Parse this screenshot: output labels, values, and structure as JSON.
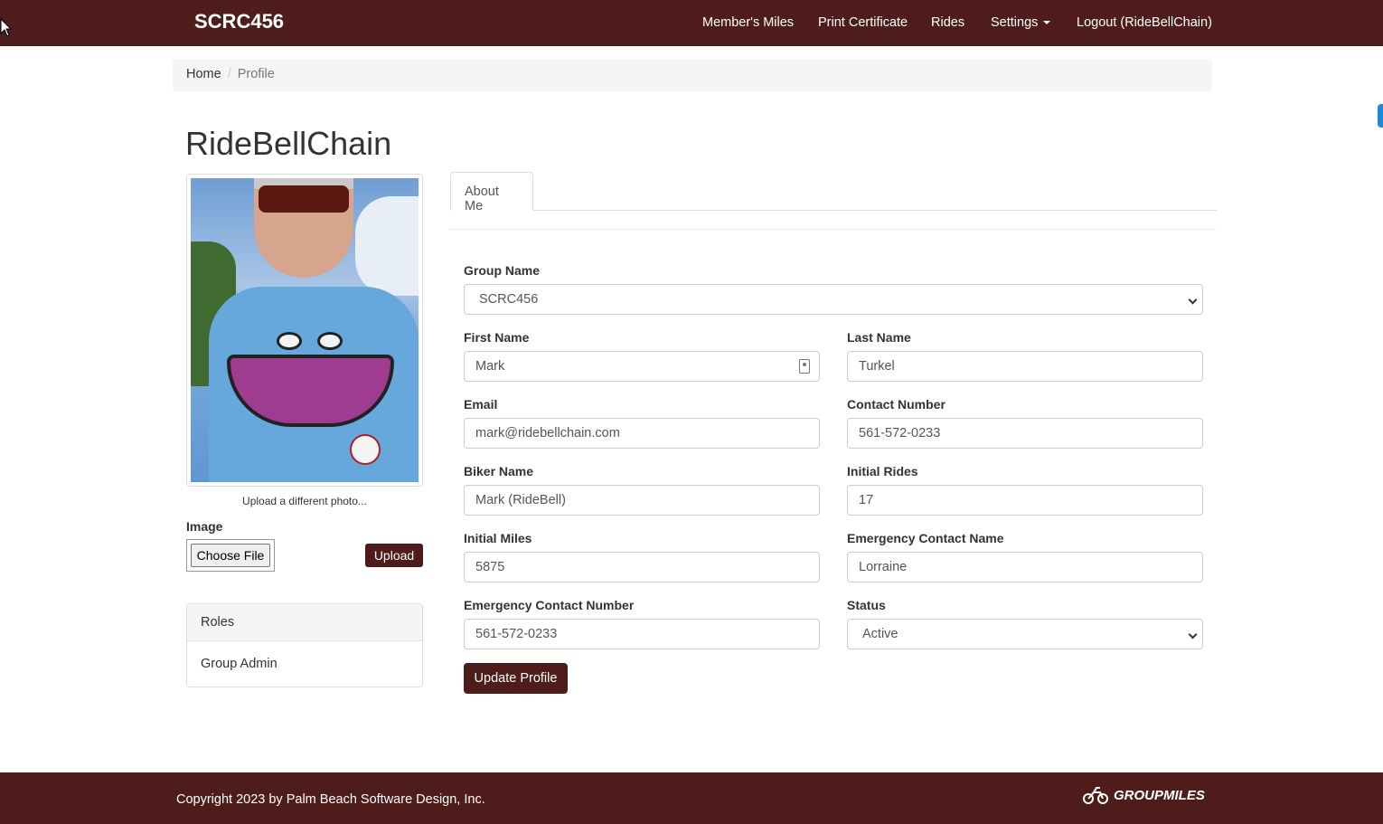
{
  "navbar": {
    "brand": "SCRC456",
    "links": [
      {
        "label": "Member's Miles"
      },
      {
        "label": "Print Certificate"
      },
      {
        "label": "Rides"
      },
      {
        "label": "Settings"
      },
      {
        "label": "Logout (RideBellChain)"
      }
    ]
  },
  "breadcrumb": {
    "home": "Home",
    "current": "Profile"
  },
  "profile": {
    "username": "RideBellChain",
    "upload_caption": "Upload a different photo...",
    "image_label": "Image",
    "choose_file_label": "Choose File",
    "upload_label": "Upload"
  },
  "roles": {
    "heading": "Roles",
    "items": [
      "Group Admin"
    ]
  },
  "tabs": [
    {
      "label": "About Me",
      "active": true
    }
  ],
  "form": {
    "group_name": {
      "label": "Group Name",
      "value": "SCRC456"
    },
    "first_name": {
      "label": "First Name",
      "value": "Mark"
    },
    "last_name": {
      "label": "Last Name",
      "value": "Turkel"
    },
    "email": {
      "label": "Email",
      "value": "mark@ridebellchain.com"
    },
    "contact_number": {
      "label": "Contact Number",
      "value": "561-572-0233"
    },
    "biker_name": {
      "label": "Biker Name",
      "value": "Mark (RideBell)"
    },
    "initial_rides": {
      "label": "Initial Rides",
      "value": "17"
    },
    "initial_miles": {
      "label": "Initial Miles",
      "value": "5875"
    },
    "emergency_contact_name": {
      "label": "Emergency Contact Name",
      "value": "Lorraine"
    },
    "emergency_contact_number": {
      "label": "Emergency Contact Number",
      "value": "561-572-0233"
    },
    "status": {
      "label": "Status",
      "value": "Active"
    },
    "submit_label": "Update Profile"
  },
  "footer": {
    "copyright": "Copyright 2023 by Palm Beach Software Design, Inc.",
    "logo_text": "GROUPMILES"
  },
  "colors": {
    "brand": "#4f1c1c",
    "accent_scroll": "#1e8ad6"
  }
}
